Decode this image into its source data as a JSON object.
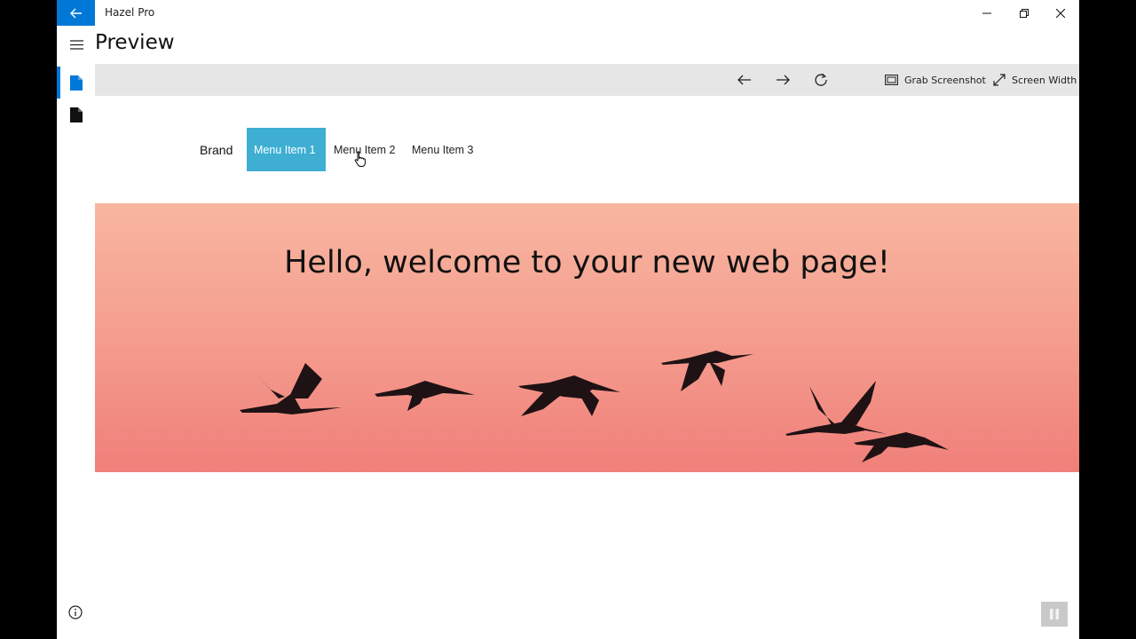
{
  "window": {
    "app_title": "Hazel Pro",
    "controls": [
      "minimize",
      "restore",
      "close"
    ]
  },
  "header": {
    "page_title": "Preview"
  },
  "sidebar": {
    "items": [
      {
        "icon": "document-icon",
        "active": true,
        "color": "#0078d7"
      },
      {
        "icon": "document-icon",
        "active": false,
        "color": "#111111"
      }
    ]
  },
  "toolbar": {
    "grab_screenshot_label": "Grab Screenshot",
    "screen_width_label": "Screen Width"
  },
  "site": {
    "brand": "Brand",
    "menu": [
      "Menu Item 1",
      "Menu Item 2",
      "Menu Item 3"
    ],
    "active_menu_index": 0,
    "hero_title": "Hello, welcome to your new web page!"
  },
  "colors": {
    "accent": "#0078d7",
    "menu_active": "#3eaed3",
    "hero_top": "#f8b6a0",
    "hero_bottom": "#f07f7a"
  }
}
